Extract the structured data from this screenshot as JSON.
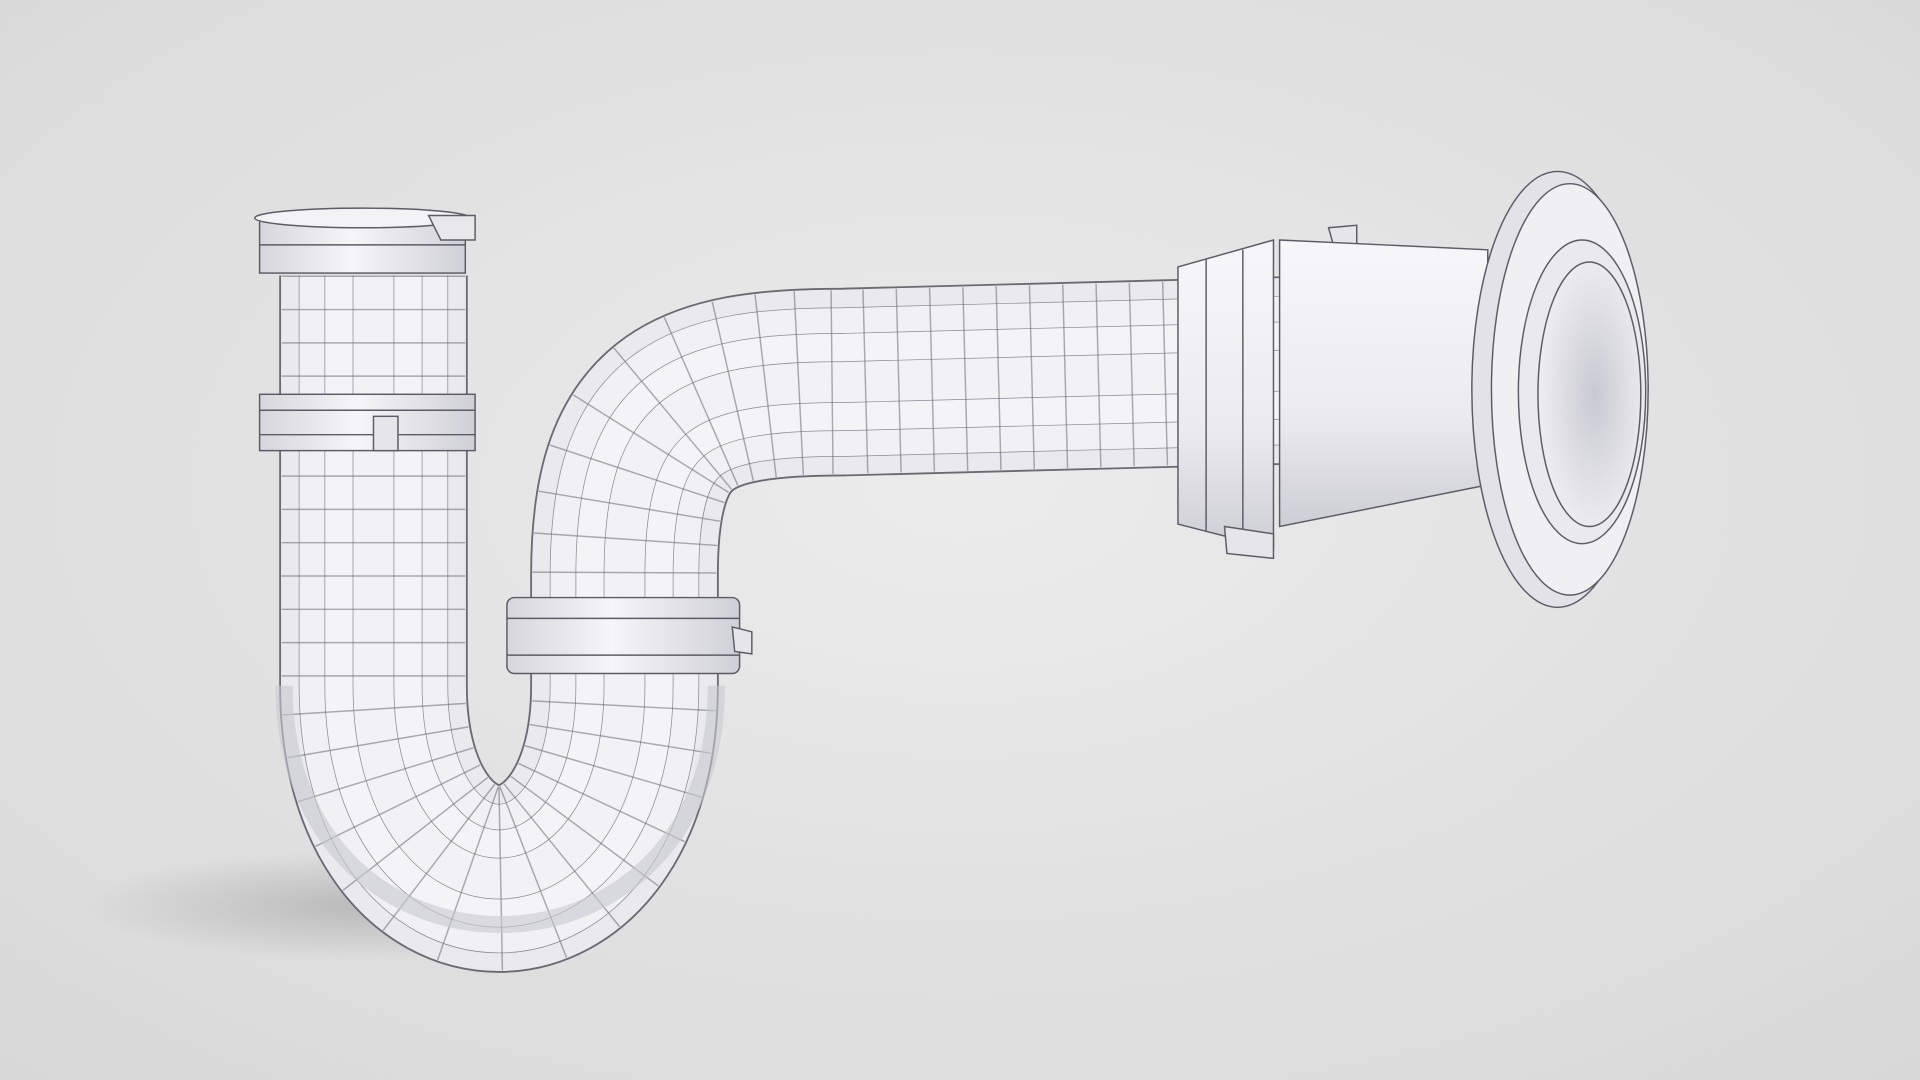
{
  "colors": {
    "background_center": "#ececec",
    "background_edge": "#d9d9d9",
    "pipe_surface": "#efeff2",
    "pipe_shade": "#cfcfd6",
    "wire": "#5c5c66",
    "shadow": "#b9b9b9"
  }
}
